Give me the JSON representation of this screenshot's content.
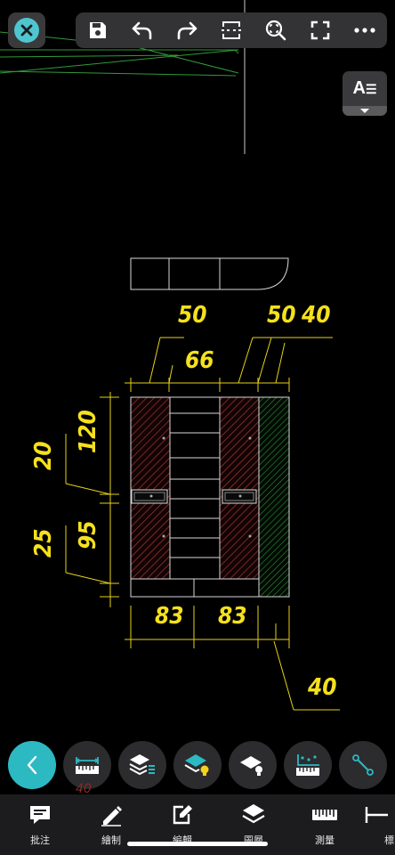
{
  "toolbar": {
    "buttons": [
      "save",
      "undo",
      "redo",
      "fit-width",
      "zoom-extents",
      "fullscreen",
      "more"
    ]
  },
  "font_button": {
    "label": "A"
  },
  "drawing": {
    "dimensions": {
      "top_50_a": "50",
      "top_50_b": "50",
      "top_40": "40",
      "top_66": "66",
      "left_20": "20",
      "left_120": "120",
      "left_25": "25",
      "left_95": "95",
      "bottom_83_a": "83",
      "bottom_83_b": "83",
      "bottom_40": "40"
    },
    "stray_text": "40"
  },
  "tools": [
    "back",
    "measure-tape",
    "layers",
    "layer-visibility",
    "layer-off",
    "measure-area",
    "line-measure"
  ],
  "bottom_nav": {
    "items": [
      {
        "label": "批注"
      },
      {
        "label": "繪制"
      },
      {
        "label": "編輯"
      },
      {
        "label": "圖層"
      },
      {
        "label": "測量"
      },
      {
        "label": "標"
      }
    ]
  },
  "colors": {
    "accent": "#2db9c2",
    "dimension_text": "#f5e11c",
    "hatch": "#b03838",
    "green_hatch": "#2f8f3a"
  }
}
